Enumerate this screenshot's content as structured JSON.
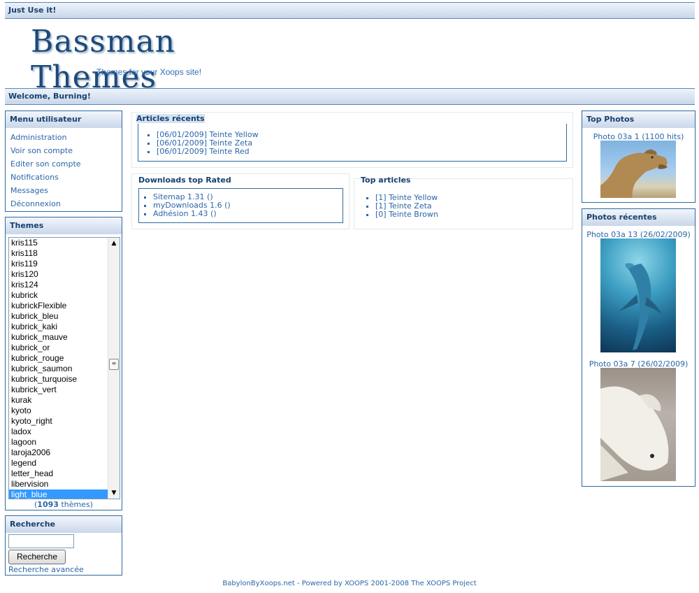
{
  "header": {
    "top_label": "Just Use it!",
    "logo_title": "Bassman Themes",
    "logo_tagline": "Themes for your Xoops site!",
    "welcome": "Welcome, Burning!"
  },
  "user_menu": {
    "title": "Menu utilisateur",
    "items": [
      "Administration",
      "Voir son compte",
      "Editer son compte",
      "Notifications",
      "Messages",
      "Déconnexion"
    ]
  },
  "themes": {
    "title": "Themes",
    "options": [
      "kris115",
      "kris118",
      "kris119",
      "kris120",
      "kris124",
      "kubrick",
      "kubrickFlexible",
      "kubrick_bleu",
      "kubrick_kaki",
      "kubrick_mauve",
      "kubrick_or",
      "kubrick_rouge",
      "kubrick_saumon",
      "kubrick_turquoise",
      "kubrick_vert",
      "kurak",
      "kyoto",
      "kyoto_right",
      "ladox",
      "lagoon",
      "laroja2006",
      "legend",
      "letter_head",
      "libervision",
      "light_blue"
    ],
    "selected": "light_blue",
    "count_open": "(",
    "count_value": "1093",
    "count_label": " thèmes)"
  },
  "search": {
    "title": "Recherche",
    "input_value": "",
    "button_label": "Recherche",
    "advanced_label": "Recherche avancée"
  },
  "recent_articles": {
    "title": "Articles récents",
    "items": [
      "[06/01/2009] Teinte Yellow",
      "[06/01/2009] Teinte Zeta",
      "[06/01/2009] Teinte Red"
    ]
  },
  "downloads": {
    "title": "Downloads top Rated",
    "items": [
      "Sitemap 1.31 ()",
      "myDownloads 1.6 ()",
      "Adhésion 1.43 ()"
    ]
  },
  "top_articles": {
    "title": "Top articles",
    "items": [
      "[1] Teinte Yellow",
      "[1] Teinte Zeta",
      "[0] Teinte Brown"
    ]
  },
  "top_photos": {
    "title": "Top Photos",
    "caption": "Photo 03a 1 (1100 hits)"
  },
  "recent_photos": {
    "title": "Photos récentes",
    "captions": [
      "Photo 03a 13 (26/02/2009)",
      "Photo 03a 7 (26/02/2009)"
    ]
  },
  "footer": {
    "text": "BabylonByXoops.net - Powered by XOOPS 2001-2008 The XOOPS Project"
  },
  "colors": {
    "accent": "#17406e",
    "link": "#2a66a9",
    "border": "#2f6a9e",
    "selection": "#3399ff"
  }
}
